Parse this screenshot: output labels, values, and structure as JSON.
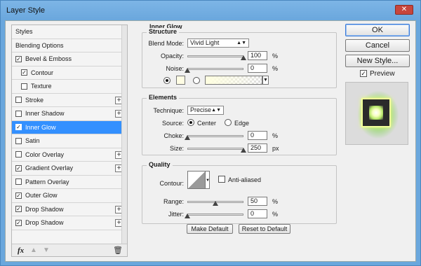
{
  "window": {
    "title": "Layer Style",
    "close_glyph": "✕"
  },
  "styles_list": {
    "items": [
      {
        "label": "Styles",
        "checkbox": false,
        "checked": false,
        "plus": false,
        "indent": false,
        "selected": false
      },
      {
        "label": "Blending Options",
        "checkbox": false,
        "checked": false,
        "plus": false,
        "indent": false,
        "selected": false
      },
      {
        "label": "Bevel & Emboss",
        "checkbox": true,
        "checked": true,
        "plus": false,
        "indent": false,
        "selected": false
      },
      {
        "label": "Contour",
        "checkbox": true,
        "checked": true,
        "plus": false,
        "indent": true,
        "selected": false
      },
      {
        "label": "Texture",
        "checkbox": true,
        "checked": false,
        "plus": false,
        "indent": true,
        "selected": false
      },
      {
        "label": "Stroke",
        "checkbox": true,
        "checked": false,
        "plus": true,
        "indent": false,
        "selected": false
      },
      {
        "label": "Inner Shadow",
        "checkbox": true,
        "checked": false,
        "plus": true,
        "indent": false,
        "selected": false
      },
      {
        "label": "Inner Glow",
        "checkbox": true,
        "checked": true,
        "plus": false,
        "indent": false,
        "selected": true
      },
      {
        "label": "Satin",
        "checkbox": true,
        "checked": false,
        "plus": false,
        "indent": false,
        "selected": false
      },
      {
        "label": "Color Overlay",
        "checkbox": true,
        "checked": false,
        "plus": true,
        "indent": false,
        "selected": false
      },
      {
        "label": "Gradient Overlay",
        "checkbox": true,
        "checked": true,
        "plus": true,
        "indent": false,
        "selected": false
      },
      {
        "label": "Pattern Overlay",
        "checkbox": true,
        "checked": false,
        "plus": false,
        "indent": false,
        "selected": false
      },
      {
        "label": "Outer Glow",
        "checkbox": true,
        "checked": true,
        "plus": false,
        "indent": false,
        "selected": false
      },
      {
        "label": "Drop Shadow",
        "checkbox": true,
        "checked": true,
        "plus": true,
        "indent": false,
        "selected": false
      },
      {
        "label": "Drop Shadow",
        "checkbox": true,
        "checked": true,
        "plus": true,
        "indent": false,
        "selected": false
      }
    ],
    "footer": {
      "fx_label": "fx",
      "up_glyph": "▲",
      "down_glyph": "▼",
      "trash_glyph": "🗑"
    }
  },
  "panel": {
    "title": "Inner Glow",
    "structure": {
      "legend": "Structure",
      "blend_mode_label": "Blend Mode:",
      "blend_mode_value": "Vivid Light",
      "opacity_label": "Opacity:",
      "opacity_value": "100",
      "opacity_level": 1.0,
      "noise_label": "Noise:",
      "noise_value": "0",
      "noise_level": 0,
      "percent": "%",
      "glow_color": "#fffde4"
    },
    "elements": {
      "legend": "Elements",
      "technique_label": "Technique:",
      "technique_value": "Precise",
      "source_label": "Source:",
      "source_center": "Center",
      "source_edge": "Edge",
      "source_selected": "Center",
      "choke_label": "Choke:",
      "choke_value": "0",
      "choke_level": 0,
      "size_label": "Size:",
      "size_value": "250",
      "size_level": 1.0,
      "percent": "%",
      "px": "px"
    },
    "quality": {
      "legend": "Quality",
      "contour_label": "Contour:",
      "anti_aliased_label": "Anti-aliased",
      "anti_aliased_checked": false,
      "range_label": "Range:",
      "range_value": "50",
      "range_level": 0.5,
      "jitter_label": "Jitter:",
      "jitter_value": "0",
      "jitter_level": 0,
      "percent": "%"
    },
    "make_default_label": "Make Default",
    "reset_default_label": "Reset to Default"
  },
  "actions": {
    "ok_label": "OK",
    "cancel_label": "Cancel",
    "new_style_label": "New Style...",
    "preview_label": "Preview",
    "preview_checked": true
  },
  "colors": {
    "selection": "#3390ff",
    "title_bar": "#6aa7dd",
    "close_button": "#c7463c"
  }
}
